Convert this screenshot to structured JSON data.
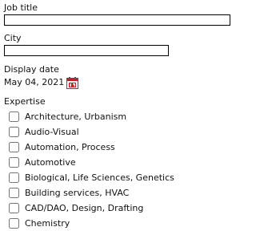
{
  "job_title": {
    "label": "Job title",
    "value": ""
  },
  "city": {
    "label": "City",
    "value": ""
  },
  "display_date": {
    "label": "Display date",
    "value": "May 04, 2021",
    "icon": "calendar-icon",
    "icon_accent": "#c41e1e"
  },
  "expertise": {
    "label": "Expertise",
    "options": [
      {
        "label": "Architecture, Urbanism",
        "checked": false
      },
      {
        "label": "Audio-Visual",
        "checked": false
      },
      {
        "label": "Automation, Process",
        "checked": false
      },
      {
        "label": "Automotive",
        "checked": false
      },
      {
        "label": "Biological, Life Sciences, Genetics",
        "checked": false
      },
      {
        "label": "Building services, HVAC",
        "checked": false
      },
      {
        "label": "CAD/DAO, Design, Drafting",
        "checked": false
      },
      {
        "label": "Chemistry",
        "checked": false
      }
    ]
  }
}
